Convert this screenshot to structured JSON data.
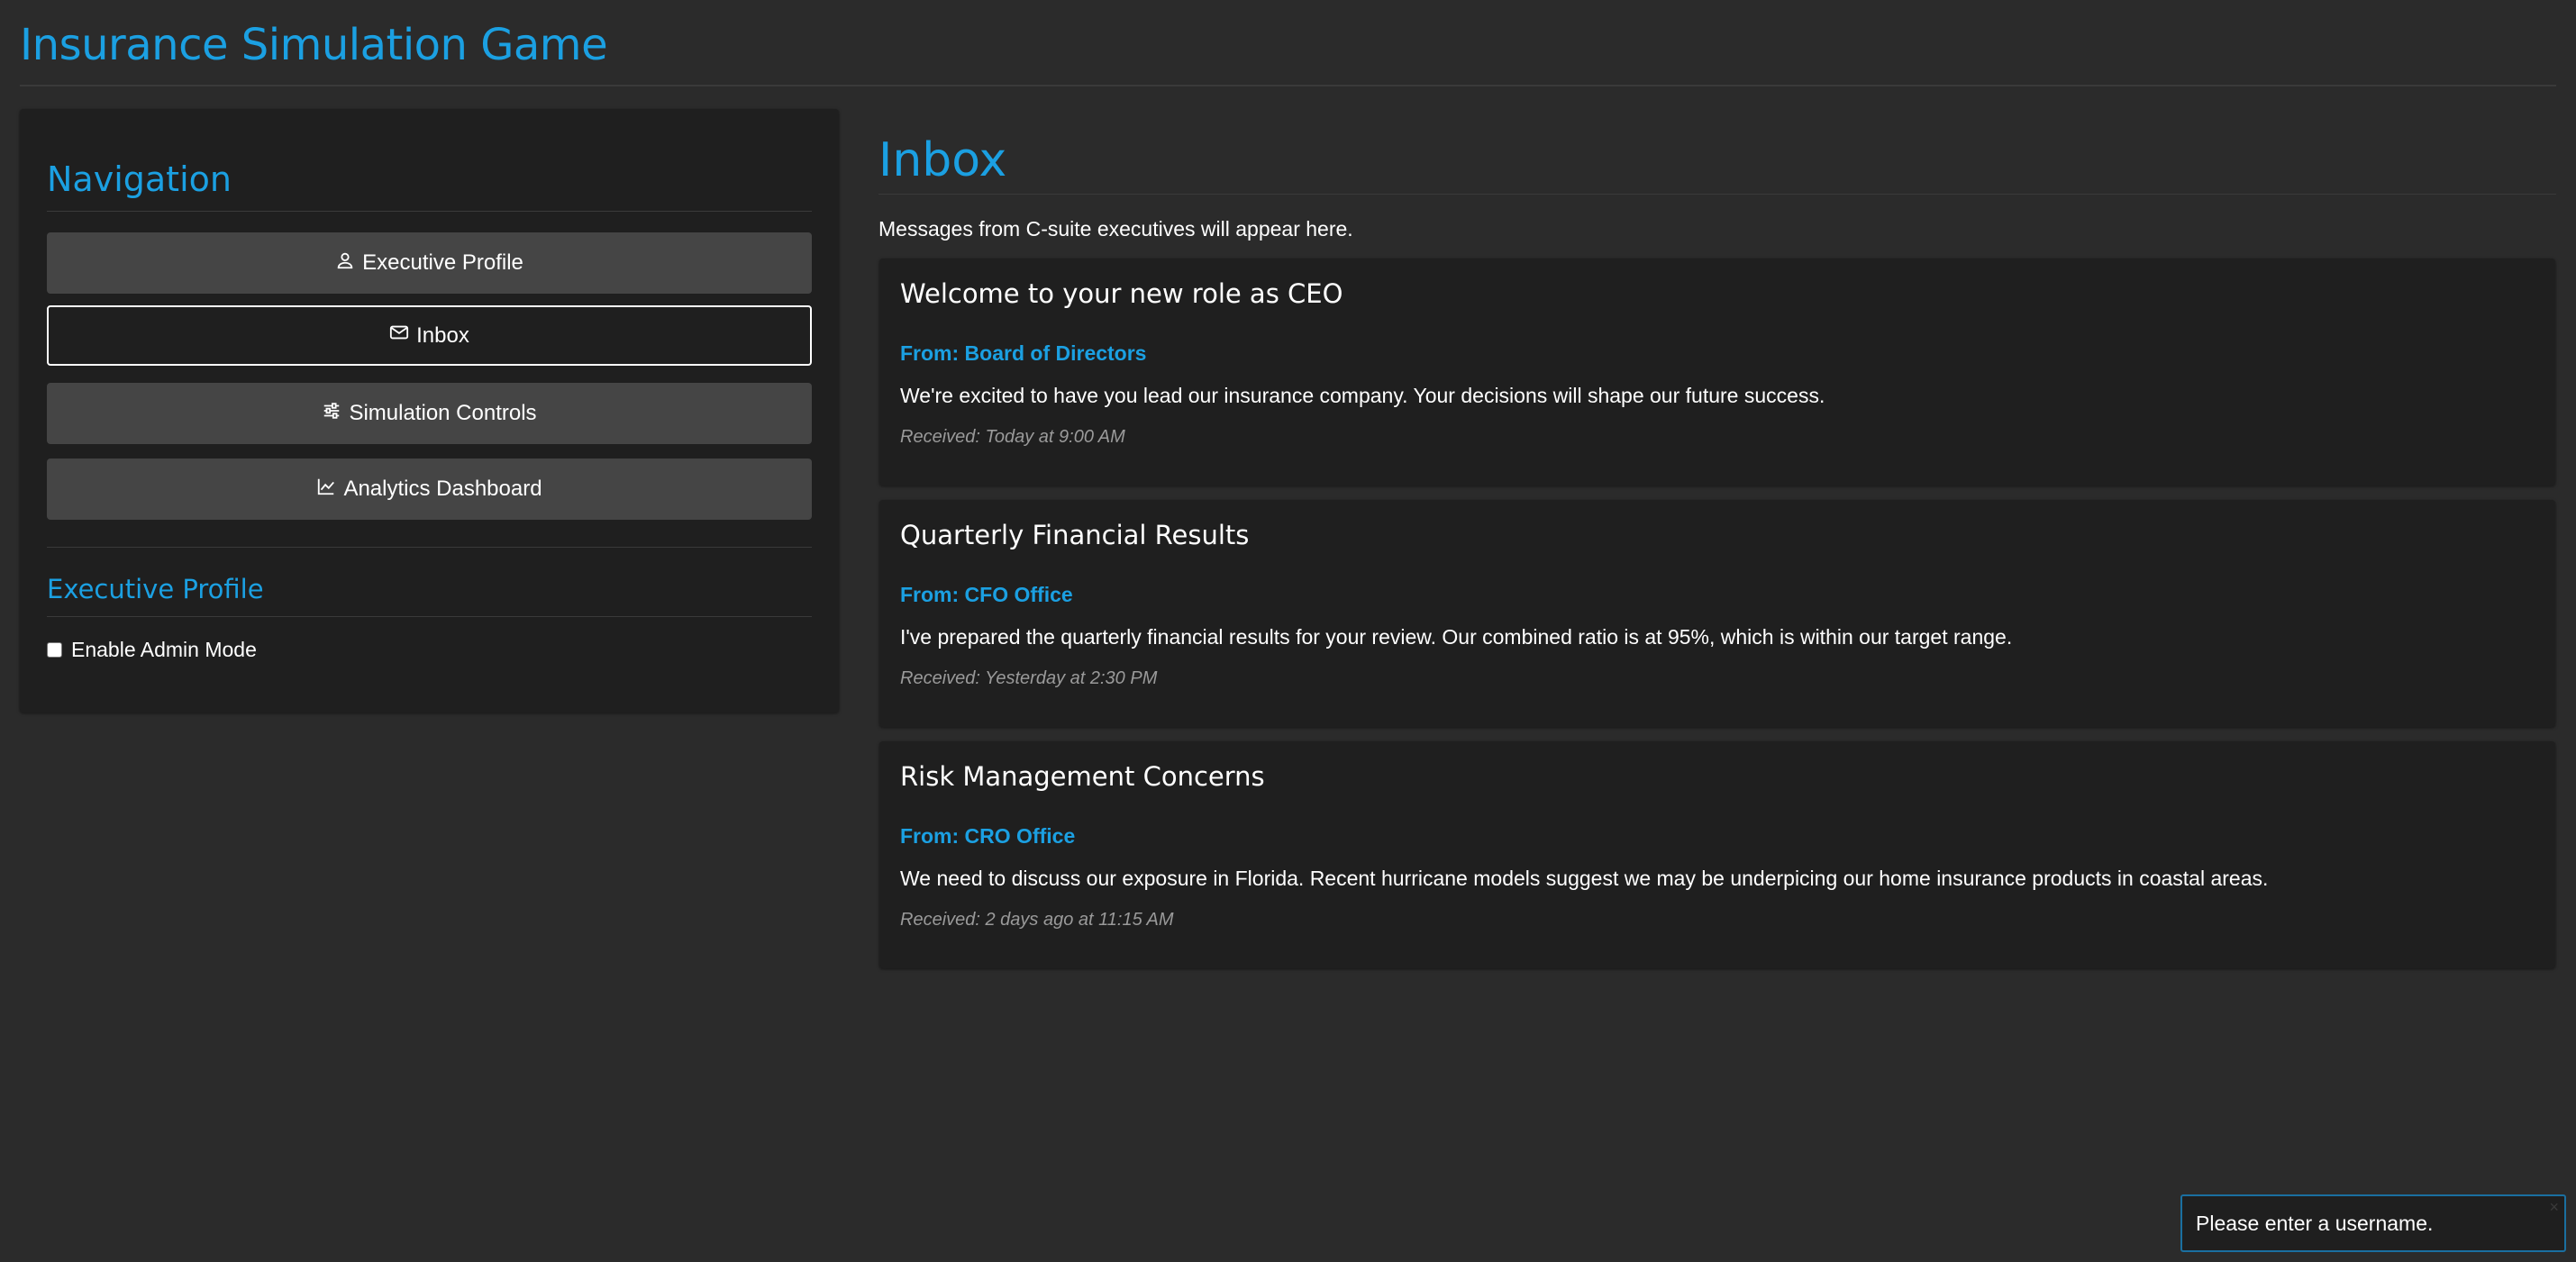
{
  "app": {
    "title": "Insurance Simulation Game"
  },
  "sidebar": {
    "nav_heading": "Navigation",
    "buttons": [
      {
        "label": "Executive Profile",
        "icon": "user-icon",
        "active": false
      },
      {
        "label": "Inbox",
        "icon": "envelope-icon",
        "active": true
      },
      {
        "label": "Simulation Controls",
        "icon": "sliders-icon",
        "active": false
      },
      {
        "label": "Analytics Dashboard",
        "icon": "chart-line-icon",
        "active": false
      }
    ],
    "profile_heading": "Executive Profile",
    "admin_mode": {
      "label": "Enable Admin Mode",
      "checked": false
    }
  },
  "inbox": {
    "title": "Inbox",
    "subtitle": "Messages from C-suite executives will appear here.",
    "messages": [
      {
        "subject": "Welcome to your new role as CEO",
        "from": "From: Board of Directors",
        "body": "We're excited to have you lead our insurance company. Your decisions will shape our future success.",
        "received": "Received: Today at 9:00 AM"
      },
      {
        "subject": "Quarterly Financial Results",
        "from": "From: CFO Office",
        "body": "I've prepared the quarterly financial results for your review. Our combined ratio is at 95%, which is within our target range.",
        "received": "Received: Yesterday at 2:30 PM"
      },
      {
        "subject": "Risk Management Concerns",
        "from": "From: CRO Office",
        "body": "We need to discuss our exposure in Florida. Recent hurricane models suggest we may be underpicing our home insurance products in coastal areas.",
        "received": "Received: 2 days ago at 11:15 AM"
      }
    ]
  },
  "toast": {
    "message": "Please enter a username.",
    "close": "×"
  },
  "colors": {
    "accent": "#1ba0e2",
    "background": "#2b2b2b",
    "panel": "#1f1f1f",
    "button": "#454545"
  }
}
